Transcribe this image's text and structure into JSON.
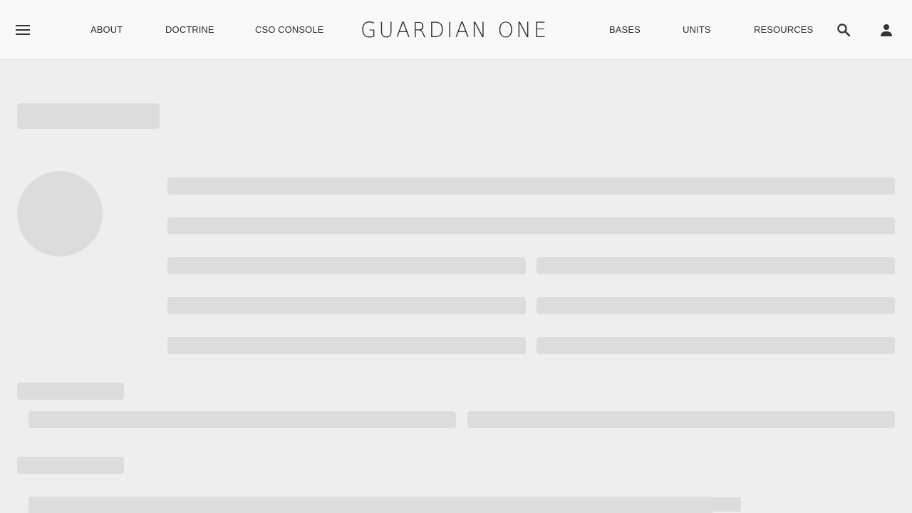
{
  "header": {
    "brand": "GUARDIAN ONE",
    "nav_left": [
      {
        "label": "ABOUT"
      },
      {
        "label": "DOCTRINE"
      },
      {
        "label": "CSO CONSOLE"
      }
    ],
    "nav_right": [
      {
        "label": "BASES"
      },
      {
        "label": "UNITS"
      },
      {
        "label": "RESOURCES"
      }
    ],
    "icons": {
      "menu": "menu-icon",
      "search": "search-icon",
      "account": "account-icon"
    }
  },
  "colors": {
    "header_bg": "#f9f8f8",
    "page_bg": "#eeeeee",
    "skeleton": "#dcdcdc",
    "text": "#2f2f2f"
  }
}
